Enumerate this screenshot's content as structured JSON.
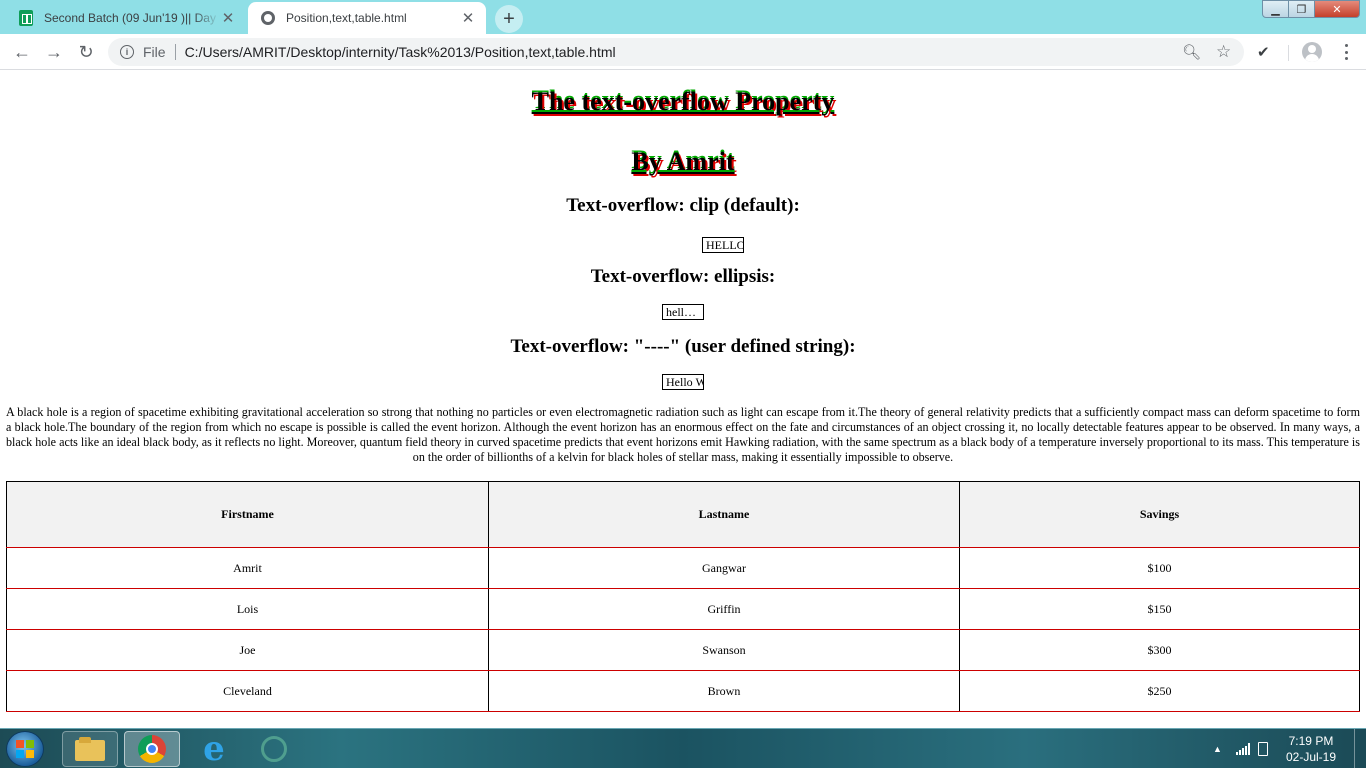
{
  "browser": {
    "tabs": [
      {
        "title": "Second Batch (09 Jun'19 )|| Day t",
        "active": false,
        "icon": "sheets-icon"
      },
      {
        "title": "Position,text,table.html",
        "active": true,
        "icon": "globe-icon"
      }
    ],
    "omnibox": {
      "scheme_label": "File",
      "url": "C:/Users/AMRIT/Desktop/internity/Task%2013/Position,text,table.html"
    }
  },
  "page": {
    "heading_main": "The text-overflow Property",
    "heading_author": "By Amrit",
    "sections": [
      {
        "heading": "Text-overflow: clip (default):",
        "demo_text": "HELLO WORLD"
      },
      {
        "heading": "Text-overflow: ellipsis:",
        "demo_text": "hello world"
      },
      {
        "heading": "Text-overflow: \"----\" (user defined string):",
        "demo_text": "Hello World"
      }
    ],
    "paragraph": "A black hole is a region of spacetime exhibiting gravitational acceleration so strong that nothing no particles or even electromagnetic radiation such as light can escape from it.The theory of general relativity predicts that a sufficiently compact mass can deform spacetime to form a black hole.The boundary of the region from which no escape is possible is called the event horizon. Although the event horizon has an enormous effect on the fate and circumstances of an object crossing it, no locally detectable features appear to be observed. In many ways, a black hole acts like an ideal black body, as it reflects no light. Moreover, quantum field theory in curved spacetime predicts that event horizons emit Hawking radiation, with the same spectrum as a black body of a temperature inversely proportional to its mass. This temperature is on the order of billionths of a kelvin for black holes of stellar mass, making it essentially impossible to observe.",
    "table": {
      "headers": [
        "Firstname",
        "Lastname",
        "Savings"
      ],
      "rows": [
        [
          "Amrit",
          "Gangwar",
          "$100"
        ],
        [
          "Lois",
          "Griffin",
          "$150"
        ],
        [
          "Joe",
          "Swanson",
          "$300"
        ],
        [
          "Cleveland",
          "Brown",
          "$250"
        ]
      ]
    }
  },
  "taskbar": {
    "time": "7:19 PM",
    "date": "02-Jul-19"
  },
  "colors": {
    "tabstrip": "#8fdfe6",
    "table_row_border": "#cc0000",
    "heading_shadow_red": "#dd0000",
    "heading_shadow_green": "#00aa00"
  }
}
